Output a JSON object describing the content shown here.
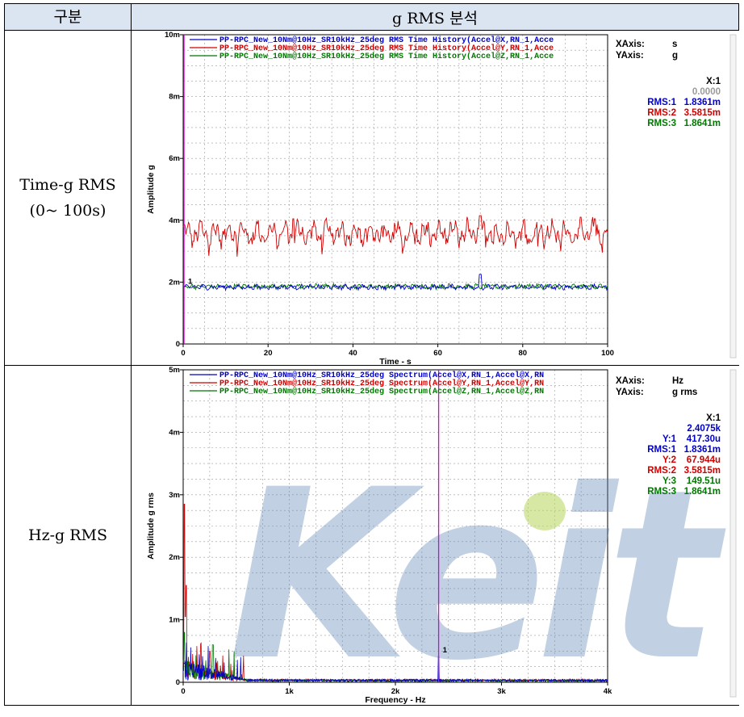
{
  "table": {
    "header_col1": "구분",
    "header_col2": "g RMS 분석",
    "row1_label_line1": "Time-g RMS",
    "row1_label_line2": "(0~ 100s)",
    "row2_label": "Hz-g RMS"
  },
  "watermark": "Keit",
  "colors": {
    "series1": "#0000c8",
    "series2": "#d00000",
    "series3": "#007800",
    "cursor": "#e000e0",
    "header_bg": "#dbe5f1"
  },
  "chart_data": [
    {
      "type": "line",
      "xlabel": "Time - s",
      "ylabel": "Amplitude g",
      "xlim": [
        0,
        100
      ],
      "ylim": [
        0,
        10
      ],
      "x_ticks": [
        "0",
        "20",
        "40",
        "60",
        "80",
        "100"
      ],
      "y_ticks": [
        "0",
        "2m",
        "4m",
        "6m",
        "8m",
        "10m"
      ],
      "grid": true,
      "legend": [
        "PP-RPC_New_10Nm@10Hz_SR10kHz_25deg RMS Time History(Accel@X,RN_1,Acce",
        "PP-RPC_New_10Nm@10Hz_SR10kHz_25deg RMS Time History(Accel@Y,RN_1,Acce",
        "PP-RPC_New_10Nm@10Hz_SR10kHz_25deg RMS Time History(Accel@Z,RN_1,Acce"
      ],
      "series": [
        {
          "name": "PP-RPC_New_10Nm@10Hz_SR10kHz_25deg RMS Time History(Accel@X,RN_1,Acce",
          "mean": 1.84,
          "spikes": [
            [
              70,
              2.25
            ]
          ]
        },
        {
          "name": "PP-RPC_New_10Nm@10Hz_SR10kHz_25deg RMS Time History(Accel@Y,RN_1,Acce",
          "mean": 3.58,
          "spikes": [
            [
              70,
              4.15
            ],
            [
              97,
              4.05
            ],
            [
              26,
              4.05
            ]
          ]
        },
        {
          "name": "PP-RPC_New_10Nm@10Hz_SR10kHz_25deg RMS Time History(Accel@Z,RN_1,Acce",
          "mean": 1.86,
          "spikes": []
        }
      ],
      "cursor_x": 0,
      "cursor_label": "1",
      "readout": {
        "xaxis_label": "XAxis:",
        "xaxis_unit": "s",
        "yaxis_label": "YAxis:",
        "yaxis_unit": "g",
        "x1_label": "X:1",
        "x1_value": "0.0000",
        "rms1_label": "RMS:1",
        "rms1_value": "1.8361m",
        "rms2_label": "RMS:2",
        "rms2_value": "3.5815m",
        "rms3_label": "RMS:3",
        "rms3_value": "1.8641m"
      }
    },
    {
      "type": "line",
      "xlabel": "Frequency - Hz",
      "ylabel": "Amplitude g rms",
      "xlim": [
        0,
        4000
      ],
      "ylim": [
        0,
        5
      ],
      "x_ticks": [
        "0",
        "1k",
        "2k",
        "3k",
        "4k"
      ],
      "y_ticks": [
        "0",
        "1m",
        "2m",
        "3m",
        "4m",
        "5m"
      ],
      "grid": true,
      "legend": [
        "PP-RPC_New_10Nm@10Hz_SR10kHz_25deg Spectrum(Accel@X,RN_1,Accel@X,RN",
        "PP-RPC_New_10Nm@10Hz_SR10kHz_25deg Spectrum(Accel@Y,RN_1,Accel@Y,RN",
        "PP-RPC_New_10Nm@10Hz_SR10kHz_25deg Spectrum(Accel@Z,RN_1,Accel@Z,RN"
      ],
      "series": [
        {
          "name": "PP-RPC_New_10Nm@10Hz_SR10kHz_25deg Spectrum(Accel@X,RN_1,Accel@X,RN",
          "peaks": [
            [
              2407,
              0.417
            ],
            [
              10,
              0.3
            ]
          ]
        },
        {
          "name": "PP-RPC_New_10Nm@10Hz_SR10kHz_25deg Spectrum(Accel@Y,RN_1,Accel@Y,RN",
          "peaks": [
            [
              10,
              2.85
            ],
            [
              30,
              1.55
            ],
            [
              20,
              1.05
            ],
            [
              250,
              0.5
            ]
          ]
        },
        {
          "name": "PP-RPC_New_10Nm@10Hz_SR10kHz_25deg Spectrum(Accel@Z,RN_1,Accel@Z,RN",
          "peaks": [
            [
              10,
              0.8
            ],
            [
              280,
              0.6
            ]
          ]
        }
      ],
      "cursor_x": 2407.5,
      "cursor_label": "1",
      "readout": {
        "xaxis_label": "XAxis:",
        "xaxis_unit": "Hz",
        "yaxis_label": "YAxis:",
        "yaxis_unit": "g rms",
        "x1_label": "X:1",
        "x1_value": "2.4075k",
        "y1_label": "Y:1",
        "y1_value": "417.30u",
        "rms1_label": "RMS:1",
        "rms1_value": "1.8361m",
        "y2_label": "Y:2",
        "y2_value": "67.944u",
        "rms2_label": "RMS:2",
        "rms2_value": "3.5815m",
        "y3_label": "Y:3",
        "y3_value": "149.51u",
        "rms3_label": "RMS:3",
        "rms3_value": "1.8641m"
      }
    }
  ]
}
